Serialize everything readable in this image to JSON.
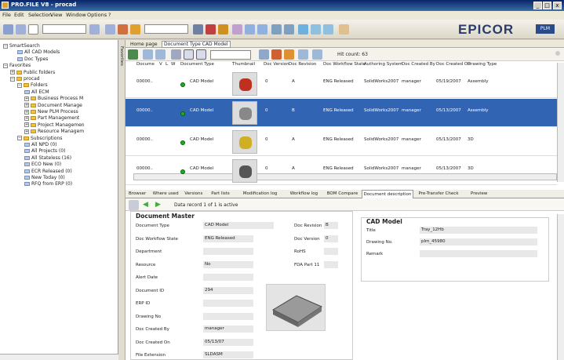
{
  "window": {
    "title": "PRO.FILE V8 - procad",
    "min": "_",
    "max": "□",
    "close": "x"
  },
  "menu": [
    "File",
    "Edit",
    "Selection",
    "View",
    "Window",
    "Options",
    "?"
  ],
  "logo": {
    "text": "EPICOR",
    "badge": "PLM"
  },
  "tree": [
    {
      "label": "SmartSearch",
      "indent": 0,
      "kind": "pm",
      "sign": "−"
    },
    {
      "label": "All CAD Models",
      "indent": 2,
      "kind": "item"
    },
    {
      "label": "Doc Types",
      "indent": 2,
      "kind": "item"
    },
    {
      "label": "Favorites",
      "indent": 0,
      "kind": "pm",
      "sign": "−"
    },
    {
      "label": "Public folders",
      "indent": 1,
      "kind": "folder",
      "sign": "+"
    },
    {
      "label": "procad",
      "indent": 1,
      "kind": "folder",
      "sign": "−"
    },
    {
      "label": "Folders",
      "indent": 2,
      "kind": "folder",
      "sign": "−"
    },
    {
      "label": "All ECM",
      "indent": 3,
      "kind": "item"
    },
    {
      "label": "Business Process M",
      "indent": 3,
      "kind": "folder",
      "sign": "+"
    },
    {
      "label": "Document Manage",
      "indent": 3,
      "kind": "folder",
      "sign": "+"
    },
    {
      "label": "New PLM Process",
      "indent": 3,
      "kind": "folder",
      "sign": "+"
    },
    {
      "label": "Part Management",
      "indent": 3,
      "kind": "folder",
      "sign": "+"
    },
    {
      "label": "Project Managemen",
      "indent": 3,
      "kind": "folder",
      "sign": "+"
    },
    {
      "label": "Resource Managem",
      "indent": 3,
      "kind": "folder",
      "sign": "+"
    },
    {
      "label": "Subscriptions",
      "indent": 2,
      "kind": "folder",
      "sign": "−"
    },
    {
      "label": "All NPD (0)",
      "indent": 3,
      "kind": "item"
    },
    {
      "label": "All Projects (0)",
      "indent": 3,
      "kind": "item"
    },
    {
      "label": "All Stateless (16)",
      "indent": 3,
      "kind": "item"
    },
    {
      "label": "ECO New (0)",
      "indent": 3,
      "kind": "item"
    },
    {
      "label": "ECR Released (0)",
      "indent": 3,
      "kind": "item"
    },
    {
      "label": "New Today (0)",
      "indent": 3,
      "kind": "item"
    },
    {
      "label": "RFQ from ERP (0)",
      "indent": 3,
      "kind": "item"
    }
  ],
  "vtab": "Favorites",
  "breadcrumb": [
    "Home page",
    "Document Type CAD Model"
  ],
  "hit_count": "Hit count: 63",
  "grid": {
    "columns": [
      "Docume",
      "V",
      "L",
      "W",
      "Document Type",
      "Thumbnail",
      "Doc Version",
      "Doc Revision",
      "Doc Workflow State",
      "Authoring System",
      "Doc Created By",
      "Doc Created On",
      "Drawing Type"
    ],
    "rows": [
      {
        "id": "00000..",
        "type": "CAD Model",
        "version": "0",
        "revision": "A",
        "state": "ENG Released",
        "system": "SolidWorks2007",
        "by": "manager",
        "on": "05/19/2007",
        "drawing": "Assembly",
        "selected": false,
        "thumb": "#c03020"
      },
      {
        "id": "00000..",
        "type": "CAD Model",
        "version": "0",
        "revision": "B",
        "state": "ENG Released",
        "system": "SolidWorks2007",
        "by": "manager",
        "on": "05/13/2007",
        "drawing": "Assembly",
        "selected": true,
        "thumb": "#888"
      },
      {
        "id": "00000..",
        "type": "CAD Model",
        "version": "0",
        "revision": "A",
        "state": "ENG Released",
        "system": "SolidWorks2007",
        "by": "manager",
        "on": "05/13/2007",
        "drawing": "3D",
        "selected": false,
        "thumb": "#d0b020"
      },
      {
        "id": "00000..",
        "type": "CAD Model",
        "version": "0",
        "revision": "A",
        "state": "ENG Released",
        "system": "SolidWorks2007",
        "by": "manager",
        "on": "05/13/2007",
        "drawing": "3D",
        "selected": false,
        "thumb": "#555"
      }
    ]
  },
  "tabs": [
    "Browser",
    "Where used",
    "Versions",
    "Part lists",
    "Modification log",
    "Workflow log",
    "BOM Compare",
    "Document description",
    "Pre-Transfer Check",
    "Preview"
  ],
  "active_tab": "Document description",
  "record_status": "Data record 1 of 1 is active",
  "doc_master": {
    "heading": "Document Master",
    "fields": [
      {
        "label": "Document Type",
        "value": "CAD Model"
      },
      {
        "label": "Doc Workflow State",
        "value": "ENG Released"
      },
      {
        "label": "Department",
        "value": ""
      },
      {
        "label": "Resource",
        "value": "No"
      },
      {
        "label": "Alert Date",
        "value": ""
      },
      {
        "label": "Document ID",
        "value": "294"
      },
      {
        "label": "ERP ID",
        "value": ""
      },
      {
        "label": "Drawing No",
        "value": ""
      },
      {
        "label": "Doc Created By",
        "value": "manager"
      },
      {
        "label": "Doc Created On",
        "value": "05/13/07"
      },
      {
        "label": "File Extension",
        "value": "SLDASM"
      }
    ],
    "right_fields": [
      {
        "label": "Doc Revision",
        "value": "B"
      },
      {
        "label": "Doc Version",
        "value": "0"
      },
      {
        "label": "RoHS",
        "value": ""
      },
      {
        "label": "FDA Part 11",
        "value": ""
      }
    ]
  },
  "cad_model": {
    "heading": "CAD Model",
    "fields": [
      {
        "label": "Title",
        "value": "Tray_12Hb"
      },
      {
        "label": "Drawing No.",
        "value": "plm_45980"
      },
      {
        "label": "Remark",
        "value": ""
      }
    ]
  }
}
